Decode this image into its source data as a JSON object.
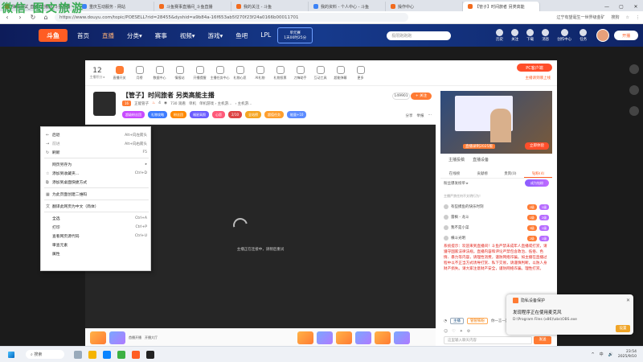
{
  "browser": {
    "tabs": [
      {
        "label": "弹幕测试_直播_直播间_斗鱼直播",
        "active": false
      },
      {
        "label": "重庆互动服务 - 网站",
        "active": false
      },
      {
        "label": "斗鱼赛事直播间_斗鱼直播",
        "active": false
      },
      {
        "label": "我的关注 - 斗鱼",
        "active": false
      },
      {
        "label": "我的资料 - 个人中心 - 斗鱼",
        "active": false
      },
      {
        "label": "操作中心",
        "active": false
      },
      {
        "label": "【管子】时间旅者 另类高能",
        "active": true
      }
    ],
    "window_controls": [
      "—",
      "▢",
      "✕"
    ],
    "url": "https://www.douyu.com/topic/POESELL?rid=28455&dyshid=a9b84a-16f653ab5f270f23f24a0166b00011701",
    "right_info": [
      "辽宁有望诞生一世界级金矿",
      "搜狗",
      "☆",
      "⋮"
    ]
  },
  "site_header": {
    "logo": "斗鱼",
    "nav": [
      "首页",
      "直播",
      "分类▾",
      "赛事",
      "视频▾",
      "游戏▾",
      "鱼吧",
      "LPL"
    ],
    "event_line1": "单元赛",
    "event_line2": "1天00时25分",
    "search_placeholder": "极限跑跑跑",
    "icons": [
      {
        "label": "历史",
        "icon": "history-icon"
      },
      {
        "label": "关注",
        "icon": "heart-icon"
      },
      {
        "label": "下载",
        "icon": "download-icon"
      },
      {
        "label": "消息",
        "icon": "message-icon"
      },
      {
        "label": "创作中心",
        "icon": "create-icon"
      },
      {
        "label": "任务",
        "icon": "task-icon"
      }
    ],
    "live_button": "开播"
  },
  "toolrow": {
    "level_number": "12",
    "level_label": "主播积分 ▸",
    "tools": [
      "直播开关",
      "月榜",
      "数据中心",
      "情报站",
      "开播提醒",
      "主播任务中心",
      "礼物心愿",
      "AI礼物",
      "礼物投票",
      "刀锋助手",
      "互动工具",
      "超能弹幕",
      "更多"
    ],
    "pc_button": "PC客户端",
    "pc_link": "主播请到哪上线"
  },
  "streamer": {
    "title": "【管子】时间旅者 另类高能主播",
    "level_badge": "16",
    "name": "正能管子",
    "heat": "4",
    "viewers": "730 观看",
    "cats": [
      "单机",
      "单机游戏 › 主机游...",
      "› 主机游..."
    ],
    "badges": [
      {
        "text": "超级粉丝团",
        "color": "#c84bff"
      },
      {
        "text": "礼物攻略",
        "color": "#3d7cff"
      },
      {
        "text": "粉丝团",
        "color": "#ff8a00"
      },
      {
        "text": "福星高照",
        "color": "#6b5cff"
      },
      {
        "text": "心愿",
        "color": "#ff5a7a"
      },
      {
        "text": "2/10",
        "color": "#d44"
      },
      {
        "text": "全站榜",
        "color": "#f5a623"
      },
      {
        "text": "超值任务",
        "color": "#ff9f2e"
      },
      {
        "text": "能量+10",
        "color": "#5c8cff"
      }
    ],
    "fans_count": "149901",
    "follow_label": "+ 关注",
    "share_items": [
      "分享",
      "举报",
      "⋯"
    ]
  },
  "player": {
    "loading_text": "主播正在连接中，请稍后重试"
  },
  "gift_labels": [
    "首播开播",
    "开播大厅"
  ],
  "right_panel": {
    "ad_label": "直播录制2025版",
    "ad_button": "立即体验",
    "ad_tabs": [
      "主播投稿",
      "直播设备"
    ],
    "panel_tabs": [
      "在线榜",
      "贡献榜",
      "贵宾(0)",
      "钻粉(4)"
    ],
    "rank_header": "粉丝爆发榜单 ▸",
    "chip": "成为钻粉",
    "notice": "主播严禁任何不文明行为！",
    "chat_rows": [
      {
        "text": "有些摸鱼的快乐时刻",
        "badge": "2级",
        "badge2": "1级"
      },
      {
        "text": "雷枫 - 龙斗",
        "badge": "1级",
        "badge2": "2级"
      },
      {
        "text": "我不是小菜",
        "badge": "3级",
        "badge2": "1级"
      },
      {
        "text": "横斗光明",
        "badge": "2级",
        "badge2": "1级"
      }
    ],
    "warning": "系统提示：欢迎来到直播间！斗鱼严禁未成年人直播或打赏，请遵守国家法律法规。直播内容和评论严禁包含政治、低俗、色情、暴力等内容，请理性消费，谨防网络诈骗。如主播在直播过程中以不正当方式诱导打赏、私下交易，请谨慎判断，以防人身财产损失。请大家注意财产安全，谨防网络诈骗。理性打赏。",
    "chat_host": "主播",
    "chat_tag": "管管铁粉",
    "chat_text": "你一言一定的吗啊！",
    "input_placeholder": "这里输入聊天内容",
    "send_label": "发送"
  },
  "context_menu": [
    {
      "label": "后退",
      "shortcut": "Alt+向左箭头",
      "icon": "back-icon",
      "disabled": false
    },
    {
      "label": "前进",
      "shortcut": "Alt+向右箭头",
      "icon": "forward-icon",
      "disabled": true
    },
    {
      "label": "刷新",
      "shortcut": "F5",
      "icon": "refresh-icon",
      "disabled": false
    },
    {
      "sep": true
    },
    {
      "label": "网页另存为",
      "shortcut": "▸",
      "icon": "",
      "disabled": false
    },
    {
      "label": "添加到收藏夹...",
      "shortcut": "Ctrl+D",
      "icon": "star-icon",
      "disabled": false
    },
    {
      "label": "添加到桌面快捷方式",
      "shortcut": "",
      "icon": "shortcut-icon",
      "disabled": false
    },
    {
      "sep": true
    },
    {
      "label": "为此页面创建二维码",
      "shortcut": "",
      "icon": "qr-icon",
      "disabled": false
    },
    {
      "sep": true
    },
    {
      "label": "翻译此网页为中文（简体）",
      "shortcut": "",
      "icon": "translate-icon",
      "disabled": false
    },
    {
      "sep": true
    },
    {
      "label": "全选",
      "shortcut": "Ctrl+A",
      "icon": "",
      "disabled": false
    },
    {
      "label": "打印",
      "shortcut": "Ctrl+P",
      "icon": "",
      "disabled": false
    },
    {
      "label": "查看网页源代码",
      "shortcut": "Ctrl+U",
      "icon": "",
      "disabled": false
    },
    {
      "label": "审查元素",
      "shortcut": "",
      "icon": "",
      "disabled": false
    },
    {
      "label": "属性",
      "shortcut": "",
      "icon": "",
      "disabled": false
    }
  ],
  "toast": {
    "app": "隐私设备保护",
    "title": "发现程序正在使用麦克风",
    "path": "D:\\Program Files (x86)\\obs\\OBS.exe",
    "button": "设置",
    "close": "✕"
  },
  "taskbar": {
    "search": "搜索",
    "tray": [
      "^",
      "中",
      "🔊"
    ],
    "time": "23:54",
    "date": "2025/9/10"
  },
  "watermark": "微信 图文旅游"
}
